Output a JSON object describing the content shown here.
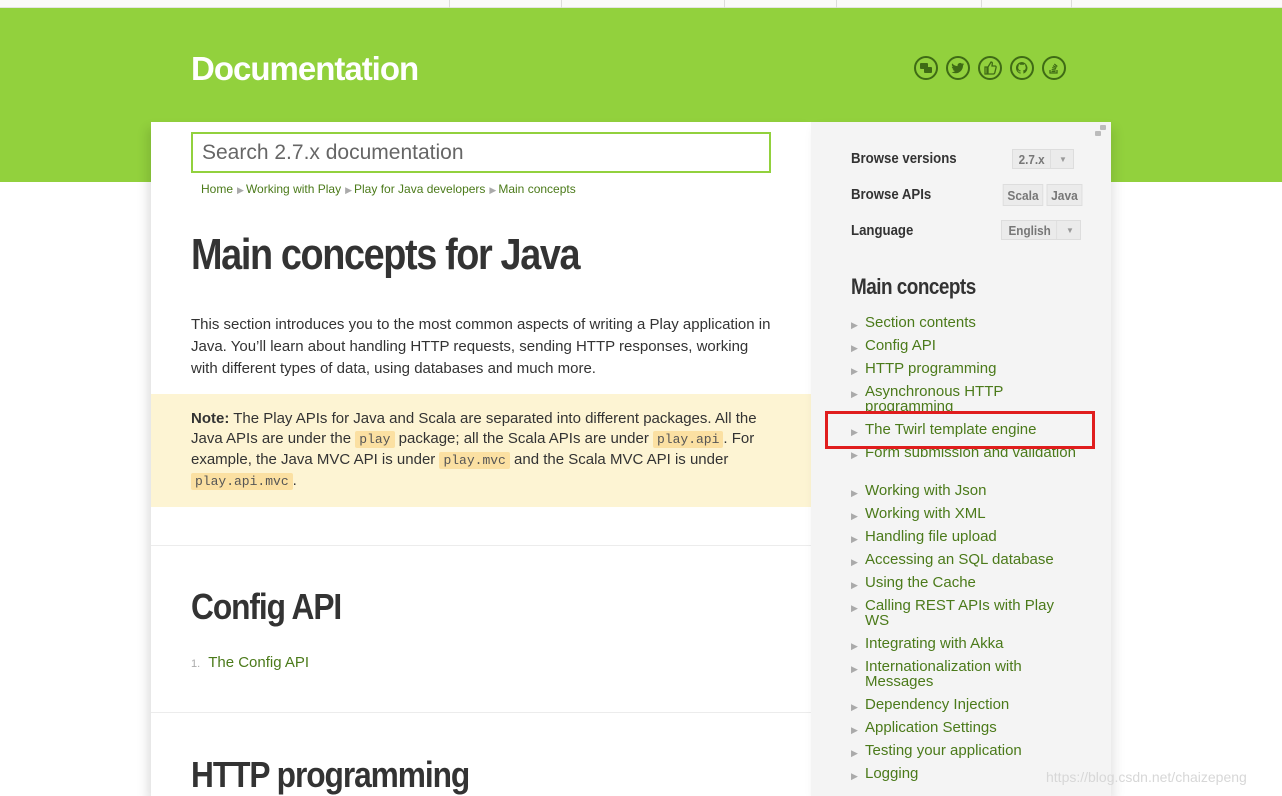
{
  "header": {
    "title": "Documentation",
    "social_icons": [
      "discuss-icon",
      "twitter-icon",
      "facebook-like-icon",
      "github-icon",
      "stackoverflow-icon"
    ]
  },
  "search": {
    "placeholder": "Search 2.7.x documentation"
  },
  "breadcrumb": [
    "Home",
    "Working with Play",
    "Play for Java developers",
    "Main concepts"
  ],
  "main": {
    "title": "Main concepts for Java",
    "intro": "This section introduces you to the most common aspects of writing a Play application in Java. You’ll learn about handling HTTP requests, sending HTTP responses, working with different types of data, using databases and much more.",
    "note": {
      "label": "Note:",
      "text1": " The Play APIs for Java and Scala are separated into different packages. All the Java APIs are under the ",
      "code1": "play",
      "text2": " package; all the Scala APIs are under ",
      "code2": "play.api",
      "text3": ". For example, the Java MVC API is under ",
      "code3": "play.mvc",
      "text4": " and the Scala MVC API is under ",
      "code4": "play.api.mvc",
      "text5": "."
    },
    "sections": [
      {
        "title": "Config API",
        "items": [
          {
            "num": "1.",
            "label": "The Config API"
          }
        ]
      },
      {
        "title": "HTTP programming"
      }
    ]
  },
  "sidebar": {
    "browse_versions_label": "Browse versions",
    "version_value": "2.7.x",
    "browse_apis_label": "Browse APIs",
    "api_tabs": [
      "Scala",
      "Java"
    ],
    "language_label": "Language",
    "language_value": "English",
    "toc_heading": "Main concepts",
    "toc": [
      "Section contents",
      "Config API",
      "HTTP programming",
      "Asynchronous HTTP programming",
      "The Twirl template engine",
      "Form submission and validation",
      "Working with Json",
      "Working with XML",
      "Handling file upload",
      "Accessing an SQL database",
      "Using the Cache",
      "Calling REST APIs with Play WS",
      "Integrating with Akka",
      "Internationalization with Messages",
      "Dependency Injection",
      "Application Settings",
      "Testing your application",
      "Logging"
    ],
    "highlighted_item": "The Twirl template engine"
  },
  "colors": {
    "brand_green": "#92d13d",
    "link_green": "#4b7a1a",
    "note_bg": "#fdf4d3",
    "highlight_red": "#e01d1d"
  },
  "watermark": "https://blog.csdn.net/chaizepeng"
}
